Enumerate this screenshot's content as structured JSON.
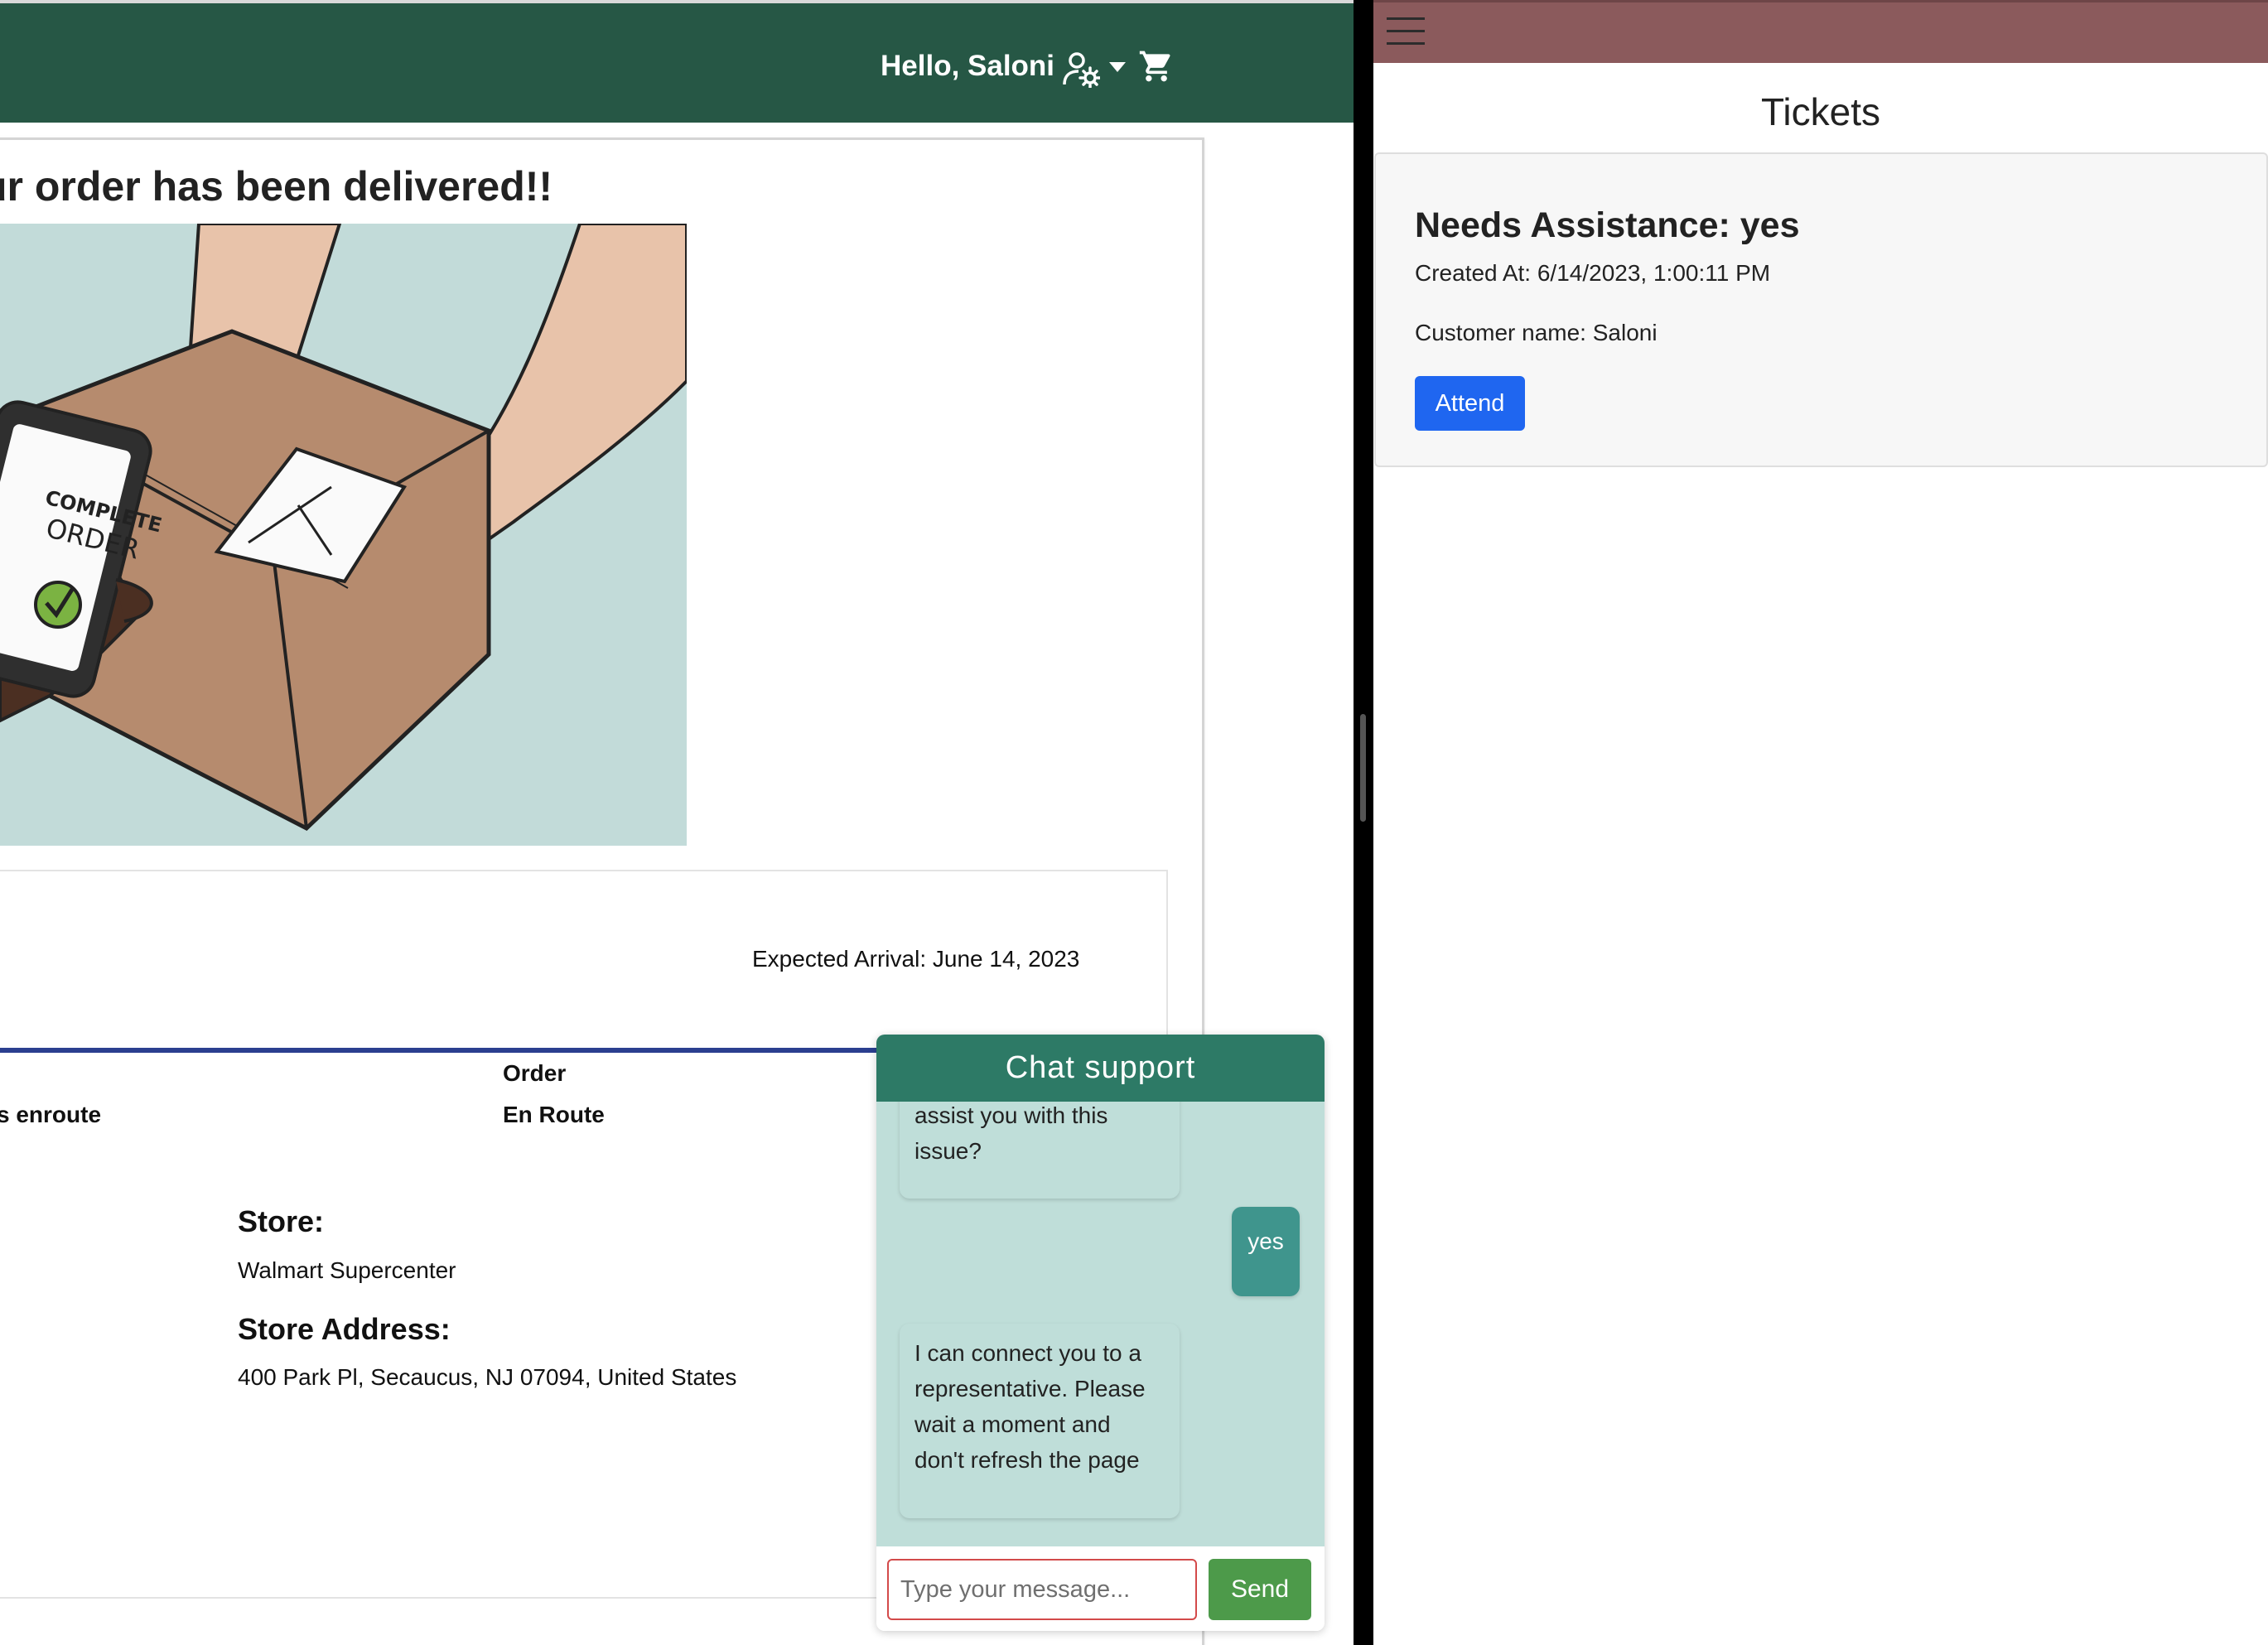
{
  "store_header": {
    "greeting": "Hello, Saloni",
    "user_icon": "user-gear-icon",
    "caret_icon": "caret-down-icon",
    "cart_icon": "cart-icon",
    "bg_color": "#265745"
  },
  "order": {
    "title": "ur order has been delivered!!",
    "illustration_label_line1": "COMPLETE",
    "illustration_label_line2": "ORDER",
    "expected_arrival": "Expected Arrival: June 14, 2023",
    "step_prev": "s enroute",
    "step_current_label": "Order",
    "step_current_status": "En Route",
    "progress_color": "#2b3f8f",
    "store_heading": "Store:",
    "store_name": "Walmart Supercenter",
    "address_heading": "Store Address:",
    "address": "400 Park Pl, Secaucus, NJ 07094, United States"
  },
  "chat": {
    "title": "Chat support",
    "messages": [
      {
        "from": "bot",
        "text": "assist you with this issue?"
      },
      {
        "from": "user",
        "text": "yes"
      },
      {
        "from": "bot",
        "text": "I can connect you to a representative. Please wait a moment and don't refresh the page"
      }
    ],
    "input_placeholder": "Type your message...",
    "send_label": "Send",
    "header_color": "#2d7a66",
    "body_color": "#bfded9",
    "send_color": "#4d9a4a"
  },
  "tickets_panel": {
    "menu_icon": "hamburger-menu-icon",
    "header_color": "#8b5a5c",
    "title": "Tickets",
    "ticket": {
      "heading": "Needs Assistance: yes",
      "created": "Created At: 6/14/2023, 1:00:11 PM",
      "customer": "Customer name: Saloni",
      "attend_label": "Attend",
      "attend_color": "#1f66f0"
    }
  }
}
